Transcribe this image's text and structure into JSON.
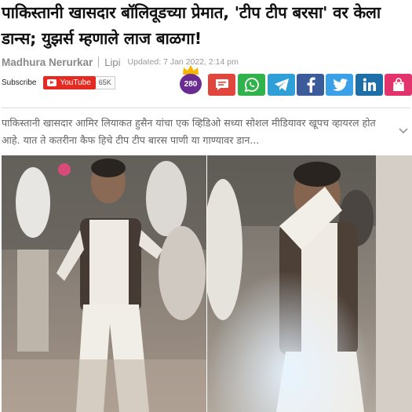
{
  "article": {
    "headline": "पाकिस्तानी खासदार बॉलिवूडच्या प्रेमात, 'टीप टीप बरसा' वर केला डान्स; युझर्स म्हणाले लाज बाळगा!",
    "author": "Madhura Nerurkar",
    "source": "Lipi",
    "updated": "Updated: 7 Jan 2022, 2:14 pm",
    "summary": "पाकिस्तानी खासदार आमिर लियाकत हुसैन यांचा एक व्हिडिओ सध्या सोशल मीडियावर खूपच व्हायरल होत आहे. यात ते कतरीना कैफ हिचे टीप टीप बारस पाणी या गाण्यावर डान..."
  },
  "subscribe": {
    "label": "Subscribe",
    "youtube_label": "YouTube",
    "count": "65K"
  },
  "comments": {
    "count": "280"
  },
  "share": [
    {
      "name": "comments-share-button",
      "icon": "chat-icon",
      "color": "#e0463c"
    },
    {
      "name": "whatsapp-share-button",
      "icon": "whatsapp-icon",
      "color": "#2fb34a"
    },
    {
      "name": "telegram-share-button",
      "icon": "telegram-icon",
      "color": "#2f9fd8"
    },
    {
      "name": "facebook-share-button",
      "icon": "facebook-icon",
      "color": "#3b5b9a"
    },
    {
      "name": "twitter-share-button",
      "icon": "twitter-icon",
      "color": "#3aa1e8"
    },
    {
      "name": "linkedin-share-button",
      "icon": "linkedin-icon",
      "color": "#1c6fa8"
    },
    {
      "name": "shop-share-button",
      "icon": "shopping-bag-icon",
      "color": "#e3336d"
    }
  ],
  "colors": {
    "youtube_red": "#e42a21",
    "comment_badge": "#6a2c91",
    "crown": "#f4b400"
  }
}
